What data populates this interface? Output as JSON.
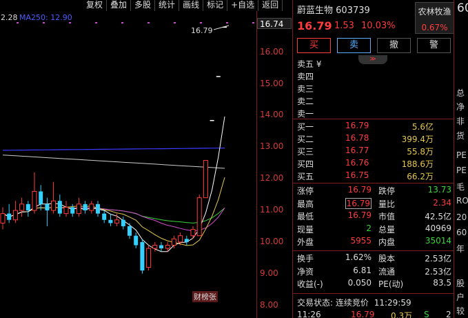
{
  "toolbar": [
    "复权",
    "叠加",
    "多股",
    "统计",
    "画线",
    "标记",
    "+自选",
    "返回"
  ],
  "legend": {
    "ma_prev": "2.28",
    "ma250": "MA250: 12.90"
  },
  "price_axis": {
    "current": "16.74",
    "labels": [
      "16.00",
      "15.00",
      "14.00",
      "13.00",
      "12.00",
      "11.00",
      "10.00",
      "9.00",
      "8.00"
    ]
  },
  "chart_annotations": {
    "high_marker": "16.79",
    "badge": "财榜张"
  },
  "chart_data": {
    "type": "candlestick",
    "ylim": [
      7.6,
      17.3
    ],
    "candles": [
      {
        "o": 10.6,
        "c": 10.9,
        "h": 11.1,
        "l": 10.4
      },
      {
        "o": 10.9,
        "c": 10.7,
        "h": 11.2,
        "l": 10.6
      },
      {
        "o": 10.7,
        "c": 11.0,
        "h": 11.3,
        "l": 10.6
      },
      {
        "o": 11.0,
        "c": 11.2,
        "h": 11.4,
        "l": 10.8
      },
      {
        "o": 11.2,
        "c": 11.0,
        "h": 11.3,
        "l": 10.8
      },
      {
        "o": 11.0,
        "c": 11.6,
        "h": 12.2,
        "l": 10.9
      },
      {
        "o": 11.6,
        "c": 11.2,
        "h": 11.8,
        "l": 11.0
      },
      {
        "o": 11.2,
        "c": 11.0,
        "h": 11.4,
        "l": 10.5
      },
      {
        "o": 11.0,
        "c": 11.3,
        "h": 11.9,
        "l": 10.9
      },
      {
        "o": 11.3,
        "c": 10.9,
        "h": 11.5,
        "l": 10.8
      },
      {
        "o": 10.9,
        "c": 11.1,
        "h": 11.3,
        "l": 10.8
      },
      {
        "o": 11.1,
        "c": 10.9,
        "h": 11.2,
        "l": 10.8
      },
      {
        "o": 10.9,
        "c": 11.2,
        "h": 11.4,
        "l": 10.8
      },
      {
        "o": 11.2,
        "c": 11.0,
        "h": 11.3,
        "l": 10.9
      },
      {
        "o": 11.0,
        "c": 11.2,
        "h": 11.3,
        "l": 10.9
      },
      {
        "o": 11.2,
        "c": 10.9,
        "h": 11.3,
        "l": 10.8
      },
      {
        "o": 10.9,
        "c": 10.7,
        "h": 11.0,
        "l": 10.6
      },
      {
        "o": 10.7,
        "c": 10.6,
        "h": 10.9,
        "l": 10.5
      },
      {
        "o": 10.6,
        "c": 10.7,
        "h": 10.9,
        "l": 10.5
      },
      {
        "o": 10.7,
        "c": 10.5,
        "h": 10.8,
        "l": 10.4
      },
      {
        "o": 10.5,
        "c": 10.2,
        "h": 10.6,
        "l": 10.1
      },
      {
        "o": 10.2,
        "c": 9.9,
        "h": 10.3,
        "l": 9.8
      },
      {
        "o": 10.0,
        "c": 9.1,
        "h": 10.1,
        "l": 9.0
      },
      {
        "o": 9.2,
        "c": 9.8,
        "h": 9.9,
        "l": 9.1
      },
      {
        "o": 9.8,
        "c": 9.9,
        "h": 10.0,
        "l": 9.7
      },
      {
        "o": 9.9,
        "c": 9.8,
        "h": 10.0,
        "l": 9.7
      },
      {
        "o": 9.8,
        "c": 9.9,
        "h": 10.0,
        "l": 9.7
      },
      {
        "o": 9.9,
        "c": 10.1,
        "h": 10.2,
        "l": 9.8
      },
      {
        "o": 10.0,
        "c": 10.2,
        "h": 10.3,
        "l": 9.9
      },
      {
        "o": 10.1,
        "c": 10.0,
        "h": 10.2,
        "l": 9.9
      },
      {
        "o": 10.2,
        "c": 10.4,
        "h": 10.5,
        "l": 10.1
      },
      {
        "o": 10.2,
        "c": 11.4,
        "h": 11.5,
        "l": 10.2
      },
      {
        "o": 11.4,
        "c": 12.58,
        "h": 12.58,
        "l": 11.4
      },
      {
        "o": 13.84,
        "c": 13.84,
        "h": 13.84,
        "l": 13.84
      },
      {
        "o": 15.23,
        "c": 15.23,
        "h": 15.23,
        "l": 15.23
      },
      {
        "o": 16.79,
        "c": 16.79,
        "h": 16.79,
        "l": 16.79
      }
    ]
  },
  "stock": {
    "name": "蔚蓝生物",
    "code": "603739",
    "price": "16.79",
    "change": "1.53",
    "pct": "10.03%",
    "sector_name": "农林牧渔",
    "sector_pct": "0.67%"
  },
  "buttons": {
    "buy": "买",
    "sell": "卖",
    "cancel": "撤",
    "alert": "警"
  },
  "arrow_tab": "≫",
  "asks": [
    {
      "label": "卖五 ¥",
      "price": "",
      "vol": ""
    },
    {
      "label": "卖四",
      "price": "",
      "vol": ""
    },
    {
      "label": "卖三",
      "price": "",
      "vol": ""
    },
    {
      "label": "卖二",
      "price": "",
      "vol": ""
    },
    {
      "label": "卖一",
      "price": "",
      "vol": ""
    }
  ],
  "bids": [
    {
      "label": "买一",
      "price": "16.79",
      "vol": "5.6亿"
    },
    {
      "label": "买二",
      "price": "16.78",
      "vol": "399.4万"
    },
    {
      "label": "买三",
      "price": "16.77",
      "vol": "55.8万"
    },
    {
      "label": "买四",
      "price": "16.76",
      "vol": "188.6万"
    },
    {
      "label": "买五",
      "price": "16.75",
      "vol": "66.2万"
    }
  ],
  "quote1": [
    {
      "k1": "涨停",
      "v1": "16.79",
      "c1": "red",
      "k2": "跌停",
      "v2": "13.73",
      "c2": "green"
    },
    {
      "k1": "最高",
      "v1": "16.79",
      "c1": "red boxed",
      "k2": "量比",
      "v2": "2.34",
      "c2": "red"
    },
    {
      "k1": "最低",
      "v1": "16.79",
      "c1": "red",
      "k2": "市值",
      "v2": "42.5亿",
      "c2": "white"
    },
    {
      "k1": "现量",
      "v1": "2",
      "c1": "green",
      "k2": "总量",
      "v2": "40969",
      "c2": "white"
    },
    {
      "k1": "外盘",
      "v1": "5955",
      "c1": "red",
      "k2": "内盘",
      "v2": "35014",
      "c2": "green"
    }
  ],
  "quote2": [
    {
      "k1": "换手",
      "v1": "1.62%",
      "c1": "white",
      "k2": "股本",
      "v2": "2.53亿",
      "c2": "white"
    },
    {
      "k1": "净资",
      "v1": "6.81",
      "c1": "white",
      "k2": "流通",
      "v2": "2.53亿",
      "c2": "white"
    },
    {
      "k1": "收益(-)",
      "v1": "0.050",
      "c1": "white",
      "k2": "PE(动)",
      "v2": "83.5",
      "c2": "white"
    }
  ],
  "status": {
    "label": "交易状态:",
    "state": "连续竞价",
    "time": "11:29:59"
  },
  "tick": {
    "time": "11:26",
    "price": "16.79",
    "vol": "0.3万",
    "side": "S",
    "count": "2"
  },
  "strip": [
    "60",
    "总",
    "净",
    "非",
    "货",
    "PE",
    "PE",
    "毛",
    "RO",
    "20",
    "60",
    "年",
    "股",
    "户",
    "较"
  ]
}
